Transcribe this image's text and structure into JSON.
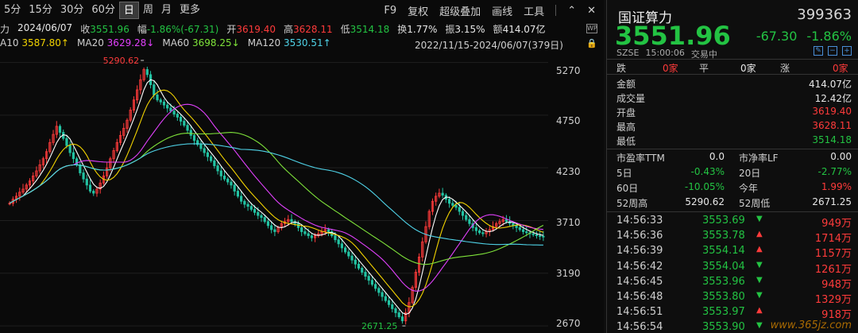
{
  "toolbar": {
    "periods": [
      "5分",
      "15分",
      "30分",
      "60分",
      "日",
      "周",
      "月",
      "更多"
    ],
    "active_period": "日",
    "tools": [
      "F9",
      "复权",
      "超级叠加",
      "画线",
      "工具"
    ]
  },
  "info1": {
    "prefix": "力",
    "date": "2024/06/07",
    "close_label": "收",
    "close": "3551.96",
    "amp_label": "幅",
    "amp": "-1.86%(-67.31)",
    "open_label": "开",
    "open": "3619.40",
    "high_label": "高",
    "high": "3628.11",
    "low_label": "低",
    "low": "3514.18",
    "turnover_label": "换",
    "turnover": "1.77%",
    "swing_label": "振",
    "swing": "3.15%",
    "amount_label": "额",
    "amount": "414.07亿"
  },
  "info2": {
    "ma10_label": "A10",
    "ma10": "3587.80↑",
    "ma20_label": "MA20",
    "ma20": "3629.28↓",
    "ma60_label": "MA60",
    "ma60": "3698.25↓",
    "ma120_label": "MA120",
    "ma120": "3530.51↑",
    "range": "2022/11/15-2024/06/07(379日)"
  },
  "chart": {
    "y_ticks": [
      "5270",
      "4750",
      "4230",
      "3710",
      "3190",
      "2670"
    ],
    "high_annotation": "5290.62",
    "low_annotation": "2671.25"
  },
  "chart_data": {
    "type": "candlestick",
    "ylim": [
      2600,
      5400
    ],
    "close": [
      3880,
      3920,
      3950,
      3990,
      4020,
      4060,
      4100,
      4150,
      4200,
      4260,
      4320,
      4390,
      4480,
      4560,
      4640,
      4580,
      4520,
      4450,
      4380,
      4320,
      4260,
      4180,
      4120,
      4060,
      4000,
      3980,
      4020,
      4080,
      4150,
      4230,
      4320,
      4400,
      4480,
      4550,
      4620,
      4700,
      4800,
      4900,
      5000,
      5100,
      5200,
      5150,
      5050,
      4950,
      4900,
      4880,
      4850,
      4820,
      4790,
      4760,
      4730,
      4690,
      4650,
      4600,
      4550,
      4500,
      4460,
      4420,
      4380,
      4340,
      4300,
      4250,
      4200,
      4150,
      4120,
      4090,
      4060,
      4000,
      3950,
      3900,
      3870,
      3850,
      3820,
      3790,
      3760,
      3740,
      3700,
      3660,
      3620,
      3600,
      3640,
      3680,
      3700,
      3720,
      3700,
      3680,
      3640,
      3600,
      3580,
      3560,
      3540,
      3560,
      3580,
      3600,
      3620,
      3600,
      3560,
      3520,
      3480,
      3440,
      3400,
      3360,
      3320,
      3280,
      3240,
      3200,
      3160,
      3120,
      3080,
      3040,
      3000,
      2960,
      2920,
      2880,
      2840,
      2800,
      2760,
      2720,
      2800,
      2900,
      3050,
      3200,
      3350,
      3500,
      3650,
      3800,
      3900,
      3950,
      3980,
      3960,
      3920,
      3880,
      3860,
      3840,
      3800,
      3760,
      3720,
      3680,
      3640,
      3610,
      3590,
      3580,
      3600,
      3620,
      3650,
      3680,
      3700,
      3720,
      3700,
      3680,
      3660,
      3640,
      3620,
      3600,
      3590,
      3580,
      3570,
      3560,
      3555,
      3552
    ],
    "ma10": "3587.80",
    "ma20": "3629.28",
    "ma60": "3698.25",
    "ma120": "3530.51"
  },
  "quote": {
    "name": "国证算力",
    "code": "399363",
    "price": "3551.96",
    "change": "-67.30",
    "change_pct": "-1.86%",
    "exchange": "SZSE",
    "time": "15:00:06",
    "status": "交易中"
  },
  "updown": {
    "fall_label": "跌",
    "fall_count": "0家",
    "flat_label": "平",
    "flat_count": "0家",
    "rise_label": "涨",
    "rise_count": "0家"
  },
  "stats": [
    {
      "k": "金额",
      "v": "414.07亿",
      "color": "white"
    },
    {
      "k": "成交量",
      "v": "12.42亿",
      "color": "white"
    },
    {
      "k": "开盘",
      "v": "3619.40",
      "color": "red"
    },
    {
      "k": "最高",
      "v": "3628.11",
      "color": "red"
    },
    {
      "k": "最低",
      "v": "3514.18",
      "color": "green"
    }
  ],
  "ratios": {
    "pe_label": "市盈率TTM",
    "pe": "0.0",
    "pb_label": "市净率LF",
    "pb": "0.00",
    "d5_label": "5日",
    "d5": "-0.43%",
    "d20_label": "20日",
    "d20": "-2.77%",
    "d60_label": "60日",
    "d60": "-10.05%",
    "ytd_label": "今年",
    "ytd": "1.99%",
    "w52h_label": "52周高",
    "w52h": "5290.62",
    "w52l_label": "52周低",
    "w52l": "2671.25"
  },
  "ticks": [
    {
      "time": "14:56:33",
      "price": "3553.69",
      "dir": "down",
      "vol": "949万"
    },
    {
      "time": "14:56:36",
      "price": "3553.78",
      "dir": "up",
      "vol": "1714万"
    },
    {
      "time": "14:56:39",
      "price": "3554.14",
      "dir": "up",
      "vol": "1157万"
    },
    {
      "time": "14:56:42",
      "price": "3554.04",
      "dir": "down",
      "vol": "1261万"
    },
    {
      "time": "14:56:45",
      "price": "3553.96",
      "dir": "down",
      "vol": "948万"
    },
    {
      "time": "14:56:48",
      "price": "3553.80",
      "dir": "down",
      "vol": "1329万"
    },
    {
      "time": "14:56:51",
      "price": "3553.97",
      "dir": "up",
      "vol": "918万"
    },
    {
      "time": "14:56:54",
      "price": "3553.90",
      "dir": "down",
      "vol": ""
    }
  ],
  "watermark": "www.365jz.com"
}
